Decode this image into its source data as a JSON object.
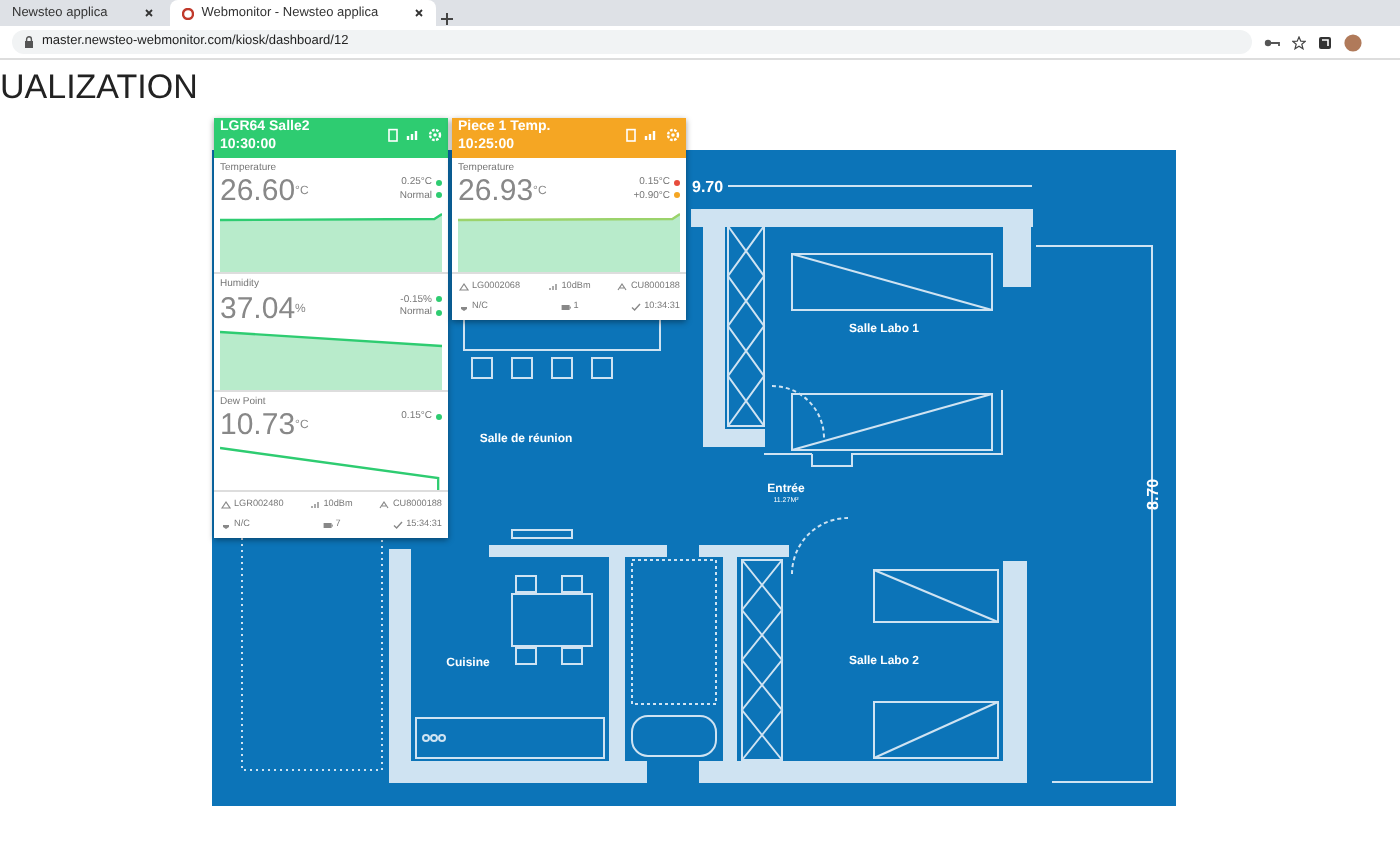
{
  "browser": {
    "tabs": [
      {
        "title": "Newsteo applica",
        "selected": false
      },
      {
        "title": "Webmonitor - Newsteo applica",
        "selected": true
      }
    ],
    "address": "master.newsteo-webmonitor.com/kiosk/dashboard/12"
  },
  "page_title": "UALIZATION",
  "floor_plan": {
    "width_label": "9.70",
    "height_label": "8.70",
    "rooms": [
      {
        "name": "Salle de réunion",
        "kind": "room"
      },
      {
        "name": "Salle Labo 1",
        "kind": "room"
      },
      {
        "name": "Entrée",
        "kind": "room",
        "area": "11.27M²"
      },
      {
        "name": "Cuisine",
        "kind": "room"
      },
      {
        "name": "Salle Labo 2",
        "kind": "room"
      }
    ]
  },
  "cards": [
    {
      "name": "LGR64 Salle2",
      "time": "10:30:00",
      "color": "#2ecc71",
      "measures": [
        {
          "label": "Temperature",
          "value": "26.60",
          "unit": "°C",
          "deltas": [
            {
              "text": "0.25°C",
              "color": "#2ecc71"
            },
            {
              "text": "Normal",
              "color": "#2ecc71"
            }
          ]
        },
        {
          "label": "Humidity",
          "value": "37.04",
          "unit": "%",
          "deltas": [
            {
              "text": "-0.15%",
              "color": "#2ecc71"
            },
            {
              "text": "Normal",
              "color": "#2ecc71"
            }
          ]
        },
        {
          "label": "Dew Point",
          "value": "10.73",
          "unit": "°C",
          "deltas": [
            {
              "text": "0.15°C",
              "color": "#2ecc71"
            }
          ]
        }
      ],
      "footer": [
        {
          "kind": "sensor",
          "text": "LGR002480"
        },
        {
          "kind": "signal",
          "text": "10dBm"
        },
        {
          "kind": "gateway",
          "text": "CU8000188"
        },
        {
          "kind": "plug",
          "text": "N/C"
        },
        {
          "kind": "battery",
          "text": "7"
        },
        {
          "kind": "time",
          "text": "15:34:31"
        }
      ]
    },
    {
      "name": "Piece 1 Temp.",
      "time": "10:25:00",
      "color": "#f5a623",
      "measures": [
        {
          "label": "Temperature",
          "value": "26.93",
          "unit": "°C",
          "deltas": [
            {
              "text": "0.15°C",
              "color": "#e74c3c"
            },
            {
              "text": "+0.90°C",
              "color": "#f5a623"
            }
          ]
        }
      ],
      "footer": [
        {
          "kind": "sensor",
          "text": "LG0002068"
        },
        {
          "kind": "signal",
          "text": "10dBm"
        },
        {
          "kind": "gateway",
          "text": "CU8000188"
        },
        {
          "kind": "plug",
          "text": "N/C"
        },
        {
          "kind": "battery",
          "text": "1"
        },
        {
          "kind": "time",
          "text": "10:34:31"
        }
      ]
    }
  ]
}
